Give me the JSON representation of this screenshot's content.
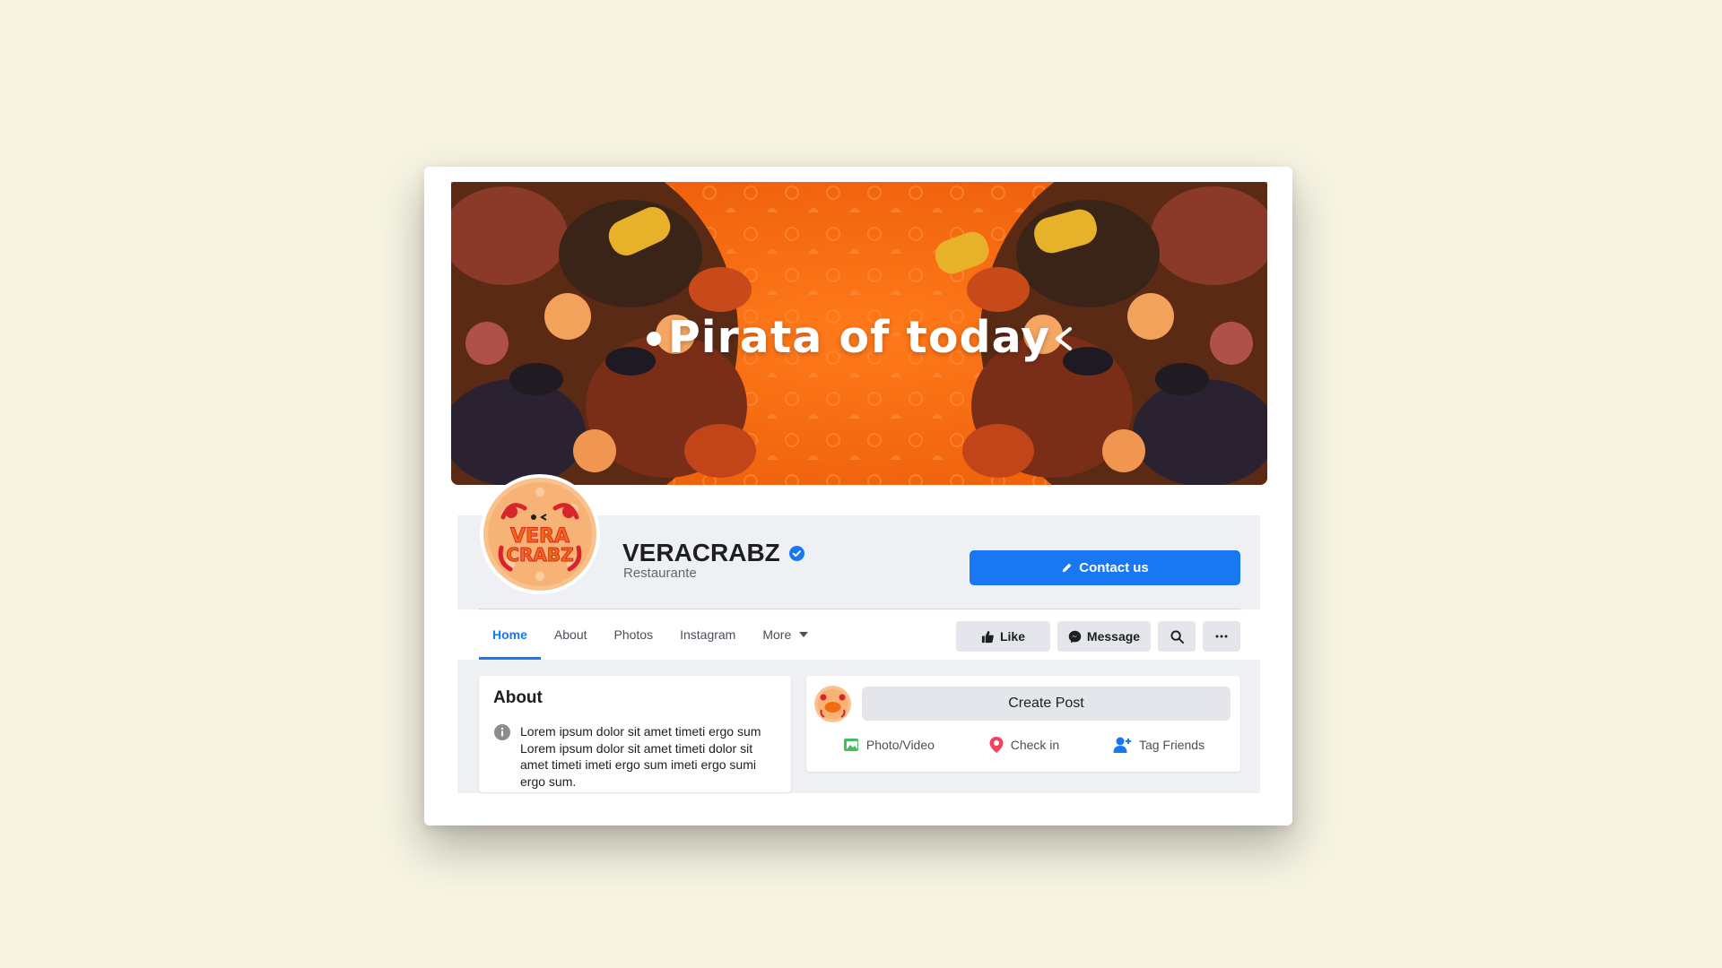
{
  "cover": {
    "title": "Pirata of today"
  },
  "page": {
    "name": "VERACRABZ",
    "category": "Restaurante",
    "logo_text": "VERA CRABZ"
  },
  "buttons": {
    "contact": "Contact us",
    "like": "Like",
    "message": "Message"
  },
  "tabs": [
    {
      "label": "Home"
    },
    {
      "label": "About"
    },
    {
      "label": "Photos"
    },
    {
      "label": "Instagram"
    },
    {
      "label": "More"
    }
  ],
  "about": {
    "title": "About",
    "text": "Lorem ipsum dolor sit amet timeti ergo sum Lorem ipsum dolor sit amet timeti dolor sit amet timeti imeti ergo sum imeti ergo sumi ergo sum."
  },
  "composer": {
    "create_post": "Create Post",
    "actions": [
      {
        "label": "Photo/Video",
        "icon": "photo-icon",
        "color": "#45bd62"
      },
      {
        "label": "Check in",
        "icon": "location-pin-icon",
        "color": "#f3425f"
      },
      {
        "label": "Tag Friends",
        "icon": "tag-friends-icon",
        "color": "#1877f2"
      }
    ]
  },
  "colors": {
    "background": "#f6f3e2",
    "brand_orange": "#f56c12",
    "accent_blue": "#1877f2",
    "logo_red": "#d7262b"
  }
}
